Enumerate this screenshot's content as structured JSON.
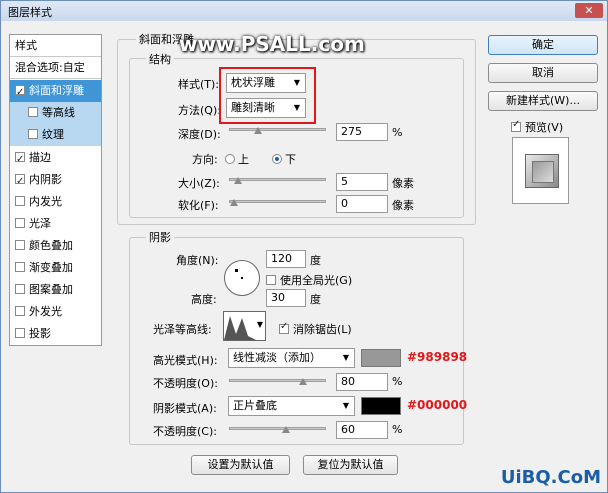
{
  "window": {
    "title": "图层样式",
    "close": "✕"
  },
  "watermark": "www.PSALL.com",
  "styles_panel": {
    "header": "样式",
    "blend_options": "混合选项:自定",
    "items": [
      {
        "label": "斜面和浮雕",
        "checked": true
      },
      {
        "label": "等高线",
        "checked": false
      },
      {
        "label": "纹理",
        "checked": false
      },
      {
        "label": "描边",
        "checked": true
      },
      {
        "label": "内阴影",
        "checked": true
      },
      {
        "label": "内发光",
        "checked": false
      },
      {
        "label": "光泽",
        "checked": false
      },
      {
        "label": "颜色叠加",
        "checked": false
      },
      {
        "label": "渐变叠加",
        "checked": false
      },
      {
        "label": "图案叠加",
        "checked": false
      },
      {
        "label": "外发光",
        "checked": false
      },
      {
        "label": "投影",
        "checked": false
      }
    ]
  },
  "bevel": {
    "section_title": "斜面和浮雕",
    "structure_title": "结构",
    "style_label": "样式(T):",
    "style_value": "枕状浮雕",
    "technique_label": "方法(Q):",
    "technique_value": "雕刻清晰",
    "depth_label": "深度(D):",
    "depth_value": "275",
    "depth_unit": "%",
    "depth_slider": 0.28,
    "direction_label": "方向:",
    "direction_up": "上",
    "direction_down": "下",
    "size_label": "大小(Z):",
    "size_value": "5",
    "size_unit": "像素",
    "size_slider": 0.05,
    "soften_label": "软化(F):",
    "soften_value": "0",
    "soften_unit": "像素",
    "soften_slider": 0.0
  },
  "shading": {
    "title": "阴影",
    "angle_label": "角度(N):",
    "angle_value": "120",
    "angle_unit": "度",
    "global_light_label": "使用全局光(G)",
    "altitude_label": "高度:",
    "altitude_value": "30",
    "altitude_unit": "度",
    "gloss_label": "光泽等高线:",
    "antialias_label": "消除锯齿(L)",
    "highlight_label": "高光模式(H):",
    "highlight_mode": "线性减淡（添加）",
    "highlight_color": "#989898",
    "highlight_color_label": "#989898",
    "highlight_opacity_label": "不透明度(O):",
    "highlight_opacity": "80",
    "highlight_opacity_slider": 0.8,
    "shadow_label": "阴影模式(A):",
    "shadow_mode": "正片叠底",
    "shadow_color": "#000000",
    "shadow_color_label": "#000000",
    "shadow_opacity_label": "不透明度(C):",
    "shadow_opacity": "60",
    "shadow_opacity_slider": 0.6,
    "percent": "%"
  },
  "bottom_buttons": {
    "make_default": "设置为默认值",
    "reset_default": "复位为默认值"
  },
  "right_buttons": {
    "ok": "确定",
    "cancel": "取消",
    "new_style": "新建样式(W)...",
    "preview": "预览(V)"
  },
  "logo": "UiBQ.CoM"
}
